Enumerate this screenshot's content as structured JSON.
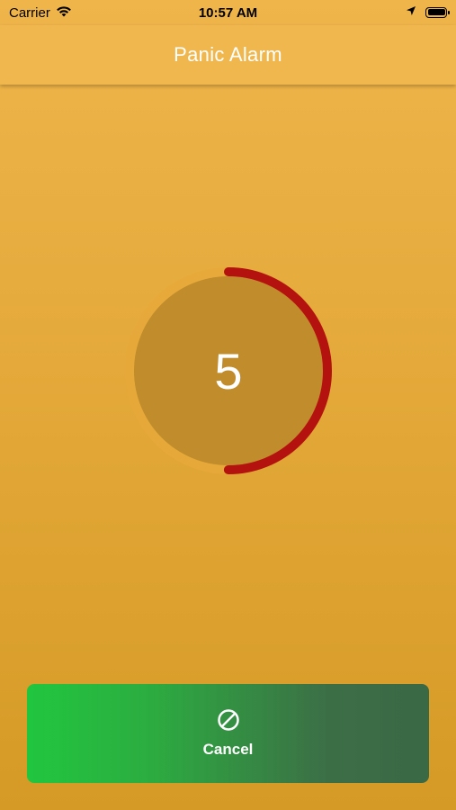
{
  "status_bar": {
    "carrier": "Carrier",
    "time": "10:57 AM",
    "icons": [
      "wifi-icon",
      "location-arrow-icon",
      "battery-icon"
    ]
  },
  "nav": {
    "title": "Panic Alarm"
  },
  "countdown": {
    "value": "5",
    "progress_fraction": 0.5,
    "ring_color": "#b3120f",
    "track_color": "#e6a83a",
    "fill_color": "#c08c2c"
  },
  "cancel_button": {
    "label": "Cancel",
    "icon": "prohibited-icon",
    "gradient_start": "#21c63f",
    "gradient_end": "#3a6945"
  }
}
